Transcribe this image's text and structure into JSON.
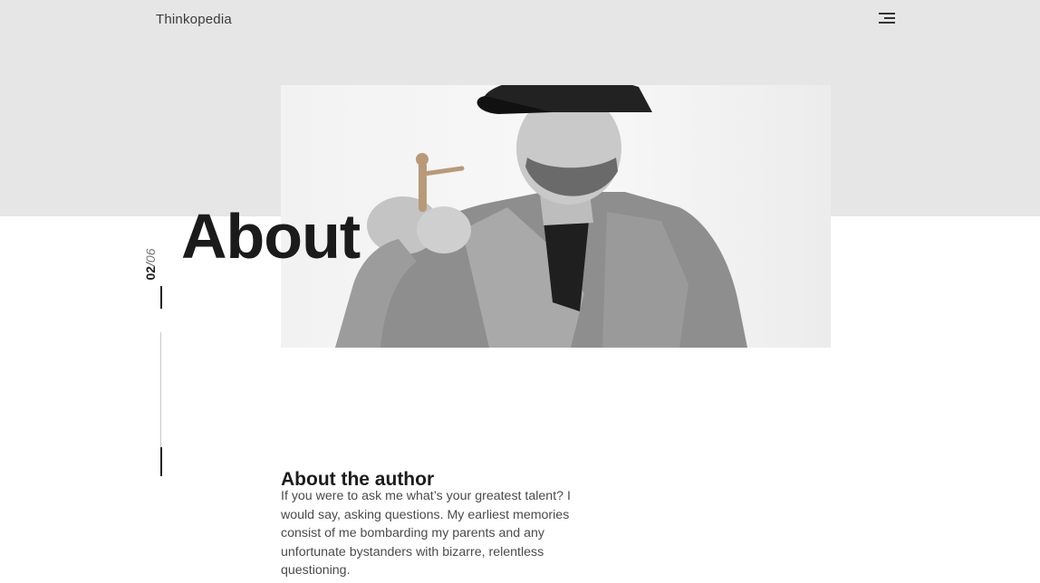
{
  "header": {
    "brand": "Thinkopedia",
    "menu_icon": "hamburger-menu-icon"
  },
  "hero": {
    "title": "About",
    "image": "black-and-white photo of a man in a cap and denim jacket holding a small wooden figurine"
  },
  "pager": {
    "current": "02",
    "separator": "/",
    "total": "06",
    "progress": 0.33
  },
  "about_author": {
    "heading": "About the author",
    "body": "If you were to ask me what’s your greatest talent? I would say, asking questions. My earliest memories consist of me bombarding my parents and any unfortunate bystanders with bizarre, relentless questioning."
  },
  "colors": {
    "top_band": "#e6e6e6",
    "background": "#ffffff",
    "text_dark": "#1c1c1c"
  }
}
